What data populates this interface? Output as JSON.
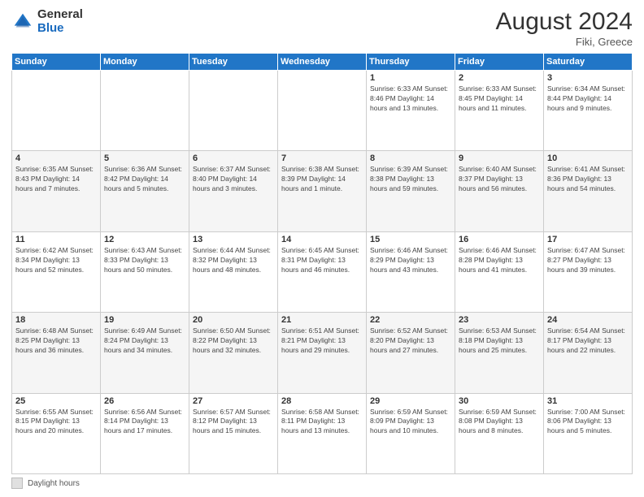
{
  "header": {
    "logo_general": "General",
    "logo_blue": "Blue",
    "month_title": "August 2024",
    "location": "Fiki, Greece"
  },
  "calendar": {
    "weekdays": [
      "Sunday",
      "Monday",
      "Tuesday",
      "Wednesday",
      "Thursday",
      "Friday",
      "Saturday"
    ],
    "weeks": [
      [
        {
          "day": "",
          "info": ""
        },
        {
          "day": "",
          "info": ""
        },
        {
          "day": "",
          "info": ""
        },
        {
          "day": "",
          "info": ""
        },
        {
          "day": "1",
          "info": "Sunrise: 6:33 AM\nSunset: 8:46 PM\nDaylight: 14 hours\nand 13 minutes."
        },
        {
          "day": "2",
          "info": "Sunrise: 6:33 AM\nSunset: 8:45 PM\nDaylight: 14 hours\nand 11 minutes."
        },
        {
          "day": "3",
          "info": "Sunrise: 6:34 AM\nSunset: 8:44 PM\nDaylight: 14 hours\nand 9 minutes."
        }
      ],
      [
        {
          "day": "4",
          "info": "Sunrise: 6:35 AM\nSunset: 8:43 PM\nDaylight: 14 hours\nand 7 minutes."
        },
        {
          "day": "5",
          "info": "Sunrise: 6:36 AM\nSunset: 8:42 PM\nDaylight: 14 hours\nand 5 minutes."
        },
        {
          "day": "6",
          "info": "Sunrise: 6:37 AM\nSunset: 8:40 PM\nDaylight: 14 hours\nand 3 minutes."
        },
        {
          "day": "7",
          "info": "Sunrise: 6:38 AM\nSunset: 8:39 PM\nDaylight: 14 hours\nand 1 minute."
        },
        {
          "day": "8",
          "info": "Sunrise: 6:39 AM\nSunset: 8:38 PM\nDaylight: 13 hours\nand 59 minutes."
        },
        {
          "day": "9",
          "info": "Sunrise: 6:40 AM\nSunset: 8:37 PM\nDaylight: 13 hours\nand 56 minutes."
        },
        {
          "day": "10",
          "info": "Sunrise: 6:41 AM\nSunset: 8:36 PM\nDaylight: 13 hours\nand 54 minutes."
        }
      ],
      [
        {
          "day": "11",
          "info": "Sunrise: 6:42 AM\nSunset: 8:34 PM\nDaylight: 13 hours\nand 52 minutes."
        },
        {
          "day": "12",
          "info": "Sunrise: 6:43 AM\nSunset: 8:33 PM\nDaylight: 13 hours\nand 50 minutes."
        },
        {
          "day": "13",
          "info": "Sunrise: 6:44 AM\nSunset: 8:32 PM\nDaylight: 13 hours\nand 48 minutes."
        },
        {
          "day": "14",
          "info": "Sunrise: 6:45 AM\nSunset: 8:31 PM\nDaylight: 13 hours\nand 46 minutes."
        },
        {
          "day": "15",
          "info": "Sunrise: 6:46 AM\nSunset: 8:29 PM\nDaylight: 13 hours\nand 43 minutes."
        },
        {
          "day": "16",
          "info": "Sunrise: 6:46 AM\nSunset: 8:28 PM\nDaylight: 13 hours\nand 41 minutes."
        },
        {
          "day": "17",
          "info": "Sunrise: 6:47 AM\nSunset: 8:27 PM\nDaylight: 13 hours\nand 39 minutes."
        }
      ],
      [
        {
          "day": "18",
          "info": "Sunrise: 6:48 AM\nSunset: 8:25 PM\nDaylight: 13 hours\nand 36 minutes."
        },
        {
          "day": "19",
          "info": "Sunrise: 6:49 AM\nSunset: 8:24 PM\nDaylight: 13 hours\nand 34 minutes."
        },
        {
          "day": "20",
          "info": "Sunrise: 6:50 AM\nSunset: 8:22 PM\nDaylight: 13 hours\nand 32 minutes."
        },
        {
          "day": "21",
          "info": "Sunrise: 6:51 AM\nSunset: 8:21 PM\nDaylight: 13 hours\nand 29 minutes."
        },
        {
          "day": "22",
          "info": "Sunrise: 6:52 AM\nSunset: 8:20 PM\nDaylight: 13 hours\nand 27 minutes."
        },
        {
          "day": "23",
          "info": "Sunrise: 6:53 AM\nSunset: 8:18 PM\nDaylight: 13 hours\nand 25 minutes."
        },
        {
          "day": "24",
          "info": "Sunrise: 6:54 AM\nSunset: 8:17 PM\nDaylight: 13 hours\nand 22 minutes."
        }
      ],
      [
        {
          "day": "25",
          "info": "Sunrise: 6:55 AM\nSunset: 8:15 PM\nDaylight: 13 hours\nand 20 minutes."
        },
        {
          "day": "26",
          "info": "Sunrise: 6:56 AM\nSunset: 8:14 PM\nDaylight: 13 hours\nand 17 minutes."
        },
        {
          "day": "27",
          "info": "Sunrise: 6:57 AM\nSunset: 8:12 PM\nDaylight: 13 hours\nand 15 minutes."
        },
        {
          "day": "28",
          "info": "Sunrise: 6:58 AM\nSunset: 8:11 PM\nDaylight: 13 hours\nand 13 minutes."
        },
        {
          "day": "29",
          "info": "Sunrise: 6:59 AM\nSunset: 8:09 PM\nDaylight: 13 hours\nand 10 minutes."
        },
        {
          "day": "30",
          "info": "Sunrise: 6:59 AM\nSunset: 8:08 PM\nDaylight: 13 hours\nand 8 minutes."
        },
        {
          "day": "31",
          "info": "Sunrise: 7:00 AM\nSunset: 8:06 PM\nDaylight: 13 hours\nand 5 minutes."
        }
      ]
    ]
  },
  "footer": {
    "legend_label": "Daylight hours"
  }
}
